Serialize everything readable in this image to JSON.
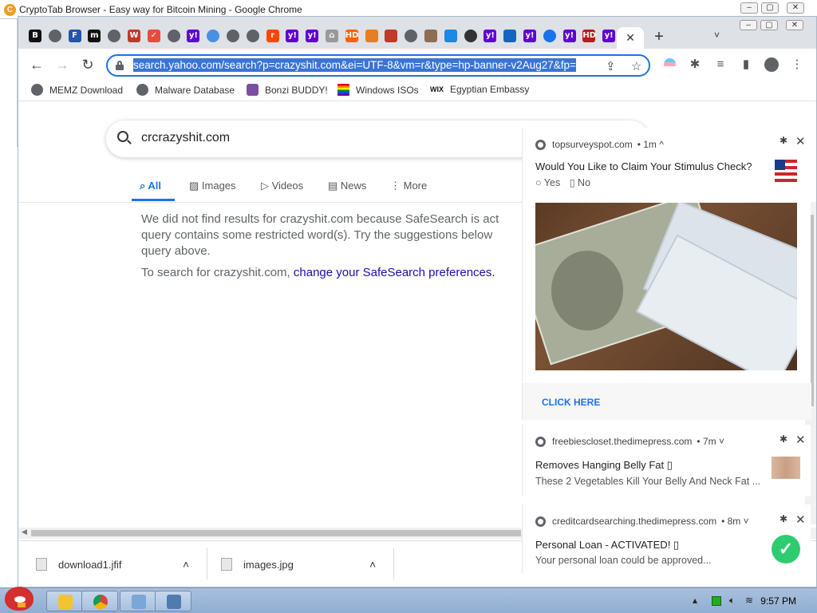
{
  "behind_window": {
    "title": "CryptoTab Browser - Easy way for Bitcoin Mining - Google Chrome",
    "logo_letter": "C"
  },
  "tabs": [
    {
      "icon": "b-icon",
      "letter": "B",
      "color": "#111111"
    },
    {
      "icon": "globe-icon",
      "letter": "",
      "color": "#5f6368"
    },
    {
      "icon": "f-icon",
      "letter": "F",
      "color": "#2255aa"
    },
    {
      "icon": "m-icon",
      "letter": "m",
      "color": "#111111"
    },
    {
      "icon": "globe-icon",
      "letter": "",
      "color": "#5f6368"
    },
    {
      "icon": "w-icon",
      "letter": "W",
      "color": "#c0392b"
    },
    {
      "icon": "check-icon",
      "letter": "✓",
      "color": "#e74c3c"
    },
    {
      "icon": "globe-icon",
      "letter": "",
      "color": "#5f6368"
    },
    {
      "icon": "yahoo-icon",
      "letter": "y!",
      "color": "#6001d2"
    },
    {
      "icon": "globe-blue-icon",
      "letter": "",
      "color": "#4a90e2"
    },
    {
      "icon": "globe-icon",
      "letter": "",
      "color": "#5f6368"
    },
    {
      "icon": "globe-icon",
      "letter": "",
      "color": "#5f6368"
    },
    {
      "icon": "reddit-icon",
      "letter": "r",
      "color": "#ff4500"
    },
    {
      "icon": "yahoo-icon",
      "letter": "y!",
      "color": "#6001d2"
    },
    {
      "icon": "yahoo-icon",
      "letter": "y!",
      "color": "#6001d2"
    },
    {
      "icon": "home-icon",
      "letter": "⌂",
      "color": "#999999"
    },
    {
      "icon": "homedepot-icon",
      "letter": "HD",
      "color": "#f96302"
    },
    {
      "icon": "rainbow-icon",
      "letter": "",
      "color": "#e67e22"
    },
    {
      "icon": "pin-icon",
      "letter": "",
      "color": "#c0392b"
    },
    {
      "icon": "globe-icon",
      "letter": "",
      "color": "#5f6368"
    },
    {
      "icon": "figure-icon",
      "letter": "",
      "color": "#8e6e53"
    },
    {
      "icon": "cloud-icon",
      "letter": "",
      "color": "#1e88e5"
    },
    {
      "icon": "clock-icon",
      "letter": "",
      "color": "#333333"
    },
    {
      "icon": "yahoo-icon",
      "letter": "y!",
      "color": "#6001d2"
    },
    {
      "icon": "tile-icon",
      "letter": "",
      "color": "#1565c0"
    },
    {
      "icon": "yahoo-icon",
      "letter": "y!",
      "color": "#6001d2"
    },
    {
      "icon": "search-icon",
      "letter": "",
      "color": "#1a73e8"
    },
    {
      "icon": "yahoo-icon",
      "letter": "y!",
      "color": "#6001d2"
    },
    {
      "icon": "hd-icon",
      "letter": "HD",
      "color": "#b71c1c"
    },
    {
      "icon": "yahoo-icon",
      "letter": "y!",
      "color": "#6001d2"
    }
  ],
  "toolbar": {
    "url": "search.yahoo.com/search?p=crazyshit.com&ei=UTF-8&vm=r&type=hp-banner-v2Aug27&fp="
  },
  "bookmarks": [
    {
      "label": "MEMZ Download",
      "icon": "globe-icon"
    },
    {
      "label": "Malware Database",
      "icon": "globe-icon"
    },
    {
      "label": "Bonzi BUDDY!",
      "icon": "bonzi-icon"
    },
    {
      "label": "Windows ISOs",
      "icon": "rainbow-flag-icon"
    },
    {
      "label": "Egyptian Embassy",
      "icon": "wix-icon",
      "prefix": "WIX"
    }
  ],
  "search": {
    "query": "crcrazyshit.com",
    "tabs": [
      "All",
      "Images",
      "Videos",
      "News",
      "More"
    ],
    "message": "We did not find results for crazyshit.com because SafeSearch is act query contains some restricted word(s). Try the suggestions below query above.",
    "hint_prefix": "To search for crazyshit.com,",
    "hint_link": "change your SafeSearch preferences."
  },
  "downloads": [
    {
      "name": "download1.jfif"
    },
    {
      "name": "images.jpg"
    }
  ],
  "notifications": [
    {
      "source": "topsurveyspot.com",
      "time": "• 1m ^",
      "title": "Would You Like to Claim Your Stimulus Check?",
      "option_yes": "○ Yes",
      "option_no": "▯ No",
      "cta": "CLICK HERE"
    },
    {
      "source": "freebiescloset.thedimepress.com",
      "time": "• 7m ˅",
      "title": "Removes Hanging Belly Fat ▯",
      "body": "These 2 Vegetables Kill Your Belly And Neck Fat ..."
    },
    {
      "source": "creditcardsearching.thedimepress.com",
      "time": "• 8m ˅",
      "title": "Personal Loan - ACTIVATED! ▯",
      "body": "Your personal loan could be approved..."
    }
  ],
  "taskbar": {
    "time": "9:57 PM"
  },
  "colors": {
    "accent": "#1a73e8",
    "yahoo": "#6001d2",
    "url_highlight": "#3a74d5"
  }
}
